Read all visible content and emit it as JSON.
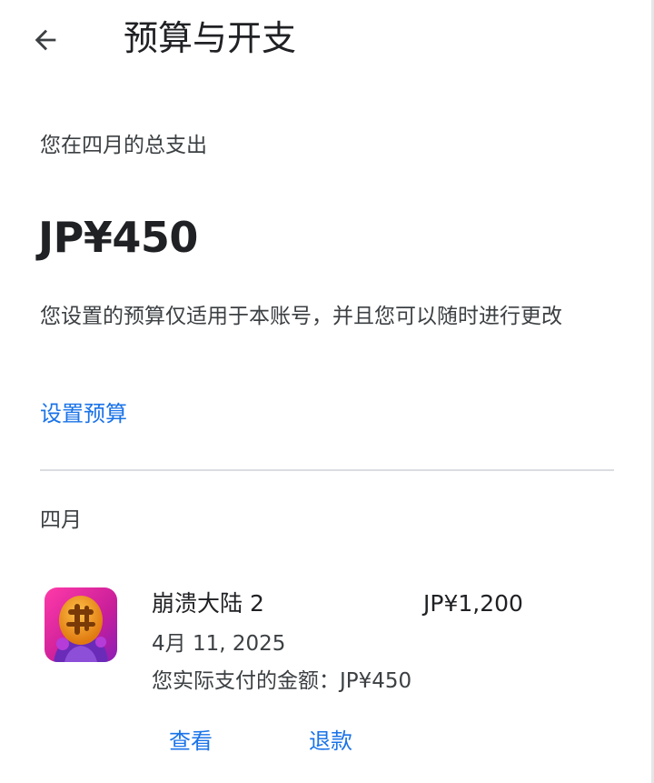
{
  "header": {
    "back_icon": "arrow-left-icon",
    "title": "预算与开支"
  },
  "summary": {
    "label": "您在四月的总支出",
    "total": "JP¥450",
    "note": "您设置的预算仅适用于本账号，并且您可以随时进行更改",
    "set_budget_label": "设置预算"
  },
  "month": {
    "header": "四月",
    "purchases": [
      {
        "icon": "game-app-icon",
        "name": "崩溃大陆 2",
        "price": "JP¥1,200",
        "date": "4月 11, 2025",
        "paid": "您实际支付的金额：JP¥450",
        "view_label": "查看",
        "refund_label": "退款"
      }
    ]
  },
  "colors": {
    "accent": "#1a73e8",
    "text_primary": "#202124",
    "text_secondary": "#3c4043",
    "divider": "#dadce0"
  }
}
